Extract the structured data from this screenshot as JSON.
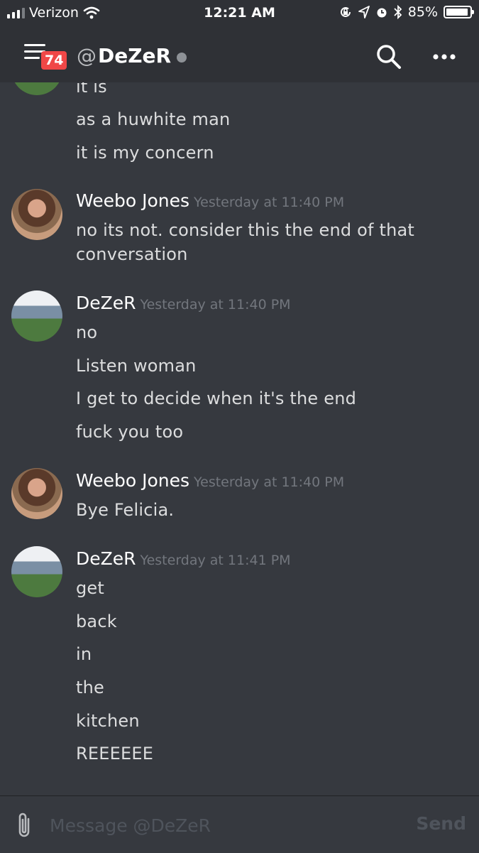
{
  "status": {
    "carrier": "Verizon",
    "time": "12:21 AM",
    "battery": "85%"
  },
  "header": {
    "badge": "74",
    "at": "@",
    "name": "DeZeR"
  },
  "messages": {
    "top": [
      "it is",
      "as a huwhite man",
      "it is my concern"
    ],
    "g1": {
      "author": "Weebo Jones",
      "time": "Yesterday at 11:40 PM",
      "lines": [
        "no its not. consider this the end of that",
        "conversation"
      ]
    },
    "g2": {
      "author": "DeZeR",
      "time": "Yesterday at 11:40 PM",
      "lines": [
        "no",
        "Listen woman",
        "I get to decide when it's the end",
        "fuck you too"
      ]
    },
    "g3": {
      "author": "Weebo Jones",
      "time": "Yesterday at 11:40 PM",
      "lines": [
        "Bye Felicia."
      ]
    },
    "g4": {
      "author": "DeZeR",
      "time": "Yesterday at 11:41 PM",
      "lines": [
        "get",
        "back",
        "in",
        "the",
        "kitchen",
        "REEEEEE"
      ]
    }
  },
  "composer": {
    "placeholder": "Message @DeZeR",
    "send": "Send"
  },
  "colors": {
    "background": "#36393f",
    "header": "#2f3136",
    "badge": "#f04747",
    "timestamp": "#72767d"
  }
}
